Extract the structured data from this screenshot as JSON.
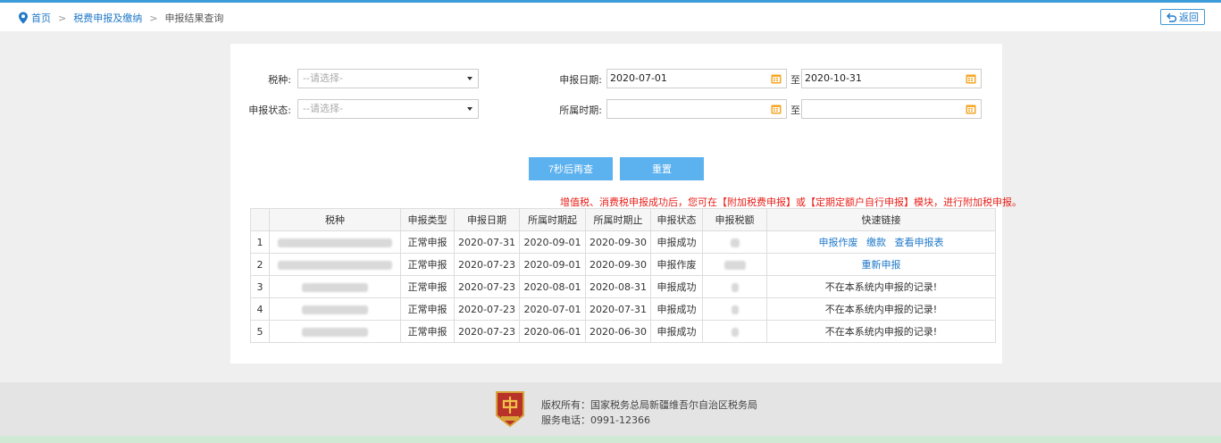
{
  "breadcrumb": {
    "home": "首页",
    "section": "税费申报及缴纳",
    "current": "申报结果查询",
    "separator": ">"
  },
  "back_button": "返回",
  "form": {
    "tax_type_label": "税种:",
    "tax_type_placeholder": "--请选择-",
    "status_label": "申报状态:",
    "status_placeholder": "--请选择-",
    "declare_date_label": "申报日期:",
    "declare_date_from": "2020-07-01",
    "declare_date_to": "2020-10-31",
    "period_label": "所属时期:",
    "period_from": "",
    "period_to": "",
    "range_sep": "至"
  },
  "buttons": {
    "query": "7秒后再查",
    "reset": "重置"
  },
  "notice": "增值税、消费税申报成功后，您可在【附加税费申报】或【定期定额户自行申报】模块，进行附加税申报。",
  "table": {
    "headers": [
      "",
      "税种",
      "申报类型",
      "申报日期",
      "所属时期起",
      "所属时期止",
      "申报状态",
      "申报税额",
      "快速链接"
    ],
    "rows": [
      {
        "no": "1",
        "type": "正常申报",
        "date": "2020-07-31",
        "from": "2020-09-01",
        "to": "2020-09-30",
        "status": "申报成功",
        "links": [
          "申报作废",
          "缴款",
          "查看申报表"
        ],
        "warn": ""
      },
      {
        "no": "2",
        "type": "正常申报",
        "date": "2020-07-23",
        "from": "2020-09-01",
        "to": "2020-09-30",
        "status": "申报作废",
        "links": [
          "重新申报"
        ],
        "warn": ""
      },
      {
        "no": "3",
        "type": "正常申报",
        "date": "2020-07-23",
        "from": "2020-08-01",
        "to": "2020-08-31",
        "status": "申报成功",
        "links": [],
        "warn": "不在本系统内申报的记录!"
      },
      {
        "no": "4",
        "type": "正常申报",
        "date": "2020-07-23",
        "from": "2020-07-01",
        "to": "2020-07-31",
        "status": "申报成功",
        "links": [],
        "warn": "不在本系统内申报的记录!"
      },
      {
        "no": "5",
        "type": "正常申报",
        "date": "2020-07-23",
        "from": "2020-06-01",
        "to": "2020-06-30",
        "status": "申报成功",
        "links": [],
        "warn": "不在本系统内申报的记录!"
      }
    ]
  },
  "footer": {
    "copyright": "版权所有：国家税务总局新疆维吾尔自治区税务局",
    "phone": "服务电话：0991-12366"
  },
  "colors": {
    "accent": "#3d9bd8",
    "button": "#5cb1ef",
    "link": "#1f78c8",
    "warning": "#e8201a"
  },
  "icons": {
    "breadcrumb": "location-pin-icon",
    "back": "return-arrow-icon",
    "date": "calendar-icon",
    "select": "caret-down-icon"
  }
}
